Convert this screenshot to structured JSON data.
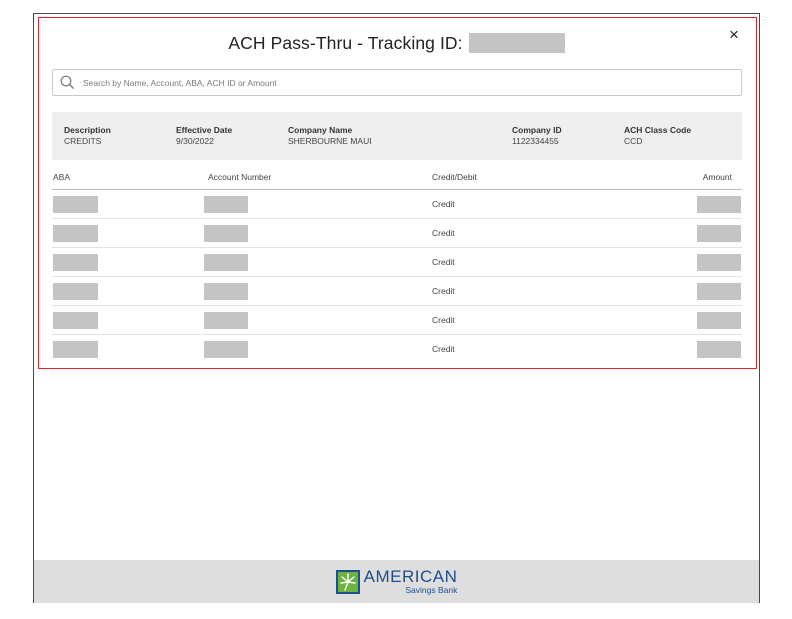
{
  "modal": {
    "title": "ACH Pass-Thru - Tracking ID:",
    "close_label": "×"
  },
  "search": {
    "placeholder": "Search by Name, Account, ABA, ACH ID or Amount",
    "value": ""
  },
  "summary": [
    {
      "label": "Description",
      "value": "CREDITS"
    },
    {
      "label": "Effective Date",
      "value": "9/30/2022"
    },
    {
      "label": "Company Name",
      "value": "SHERBOURNE MAUI"
    },
    {
      "label": "Company ID",
      "value": "1122334455"
    },
    {
      "label": "ACH Class Code",
      "value": "CCD"
    }
  ],
  "table": {
    "headers": [
      "ABA",
      "Account Number",
      "Credit/Debit",
      "Amount"
    ],
    "rows": [
      {
        "credit_debit": "Credit"
      },
      {
        "credit_debit": "Credit"
      },
      {
        "credit_debit": "Credit"
      },
      {
        "credit_debit": "Credit"
      },
      {
        "credit_debit": "Credit"
      },
      {
        "credit_debit": "Credit"
      }
    ]
  },
  "footer": {
    "logo_main": "AMERICAN",
    "logo_sub": "Savings Bank"
  },
  "colors": {
    "highlight_border": "#e0262b",
    "redaction": "#c4c4c4",
    "info_band": "#efefef",
    "footer_bg": "#dedede",
    "brand_blue": "#1d4f8c",
    "brand_green": "#6cb33f"
  },
  "icons": [
    "search-icon",
    "close-icon",
    "bank-logo-icon"
  ]
}
